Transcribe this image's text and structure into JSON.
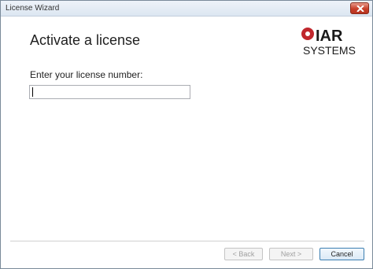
{
  "window": {
    "title": "License Wizard"
  },
  "page": {
    "heading": "Activate a license",
    "field_label": "Enter your license number:"
  },
  "license_input": {
    "value": "",
    "placeholder": ""
  },
  "logo": {
    "line1": "IAR",
    "line2": "SYSTEMS",
    "color": "#c0272d"
  },
  "buttons": {
    "back": "< Back",
    "next": "Next >",
    "cancel": "Cancel"
  }
}
